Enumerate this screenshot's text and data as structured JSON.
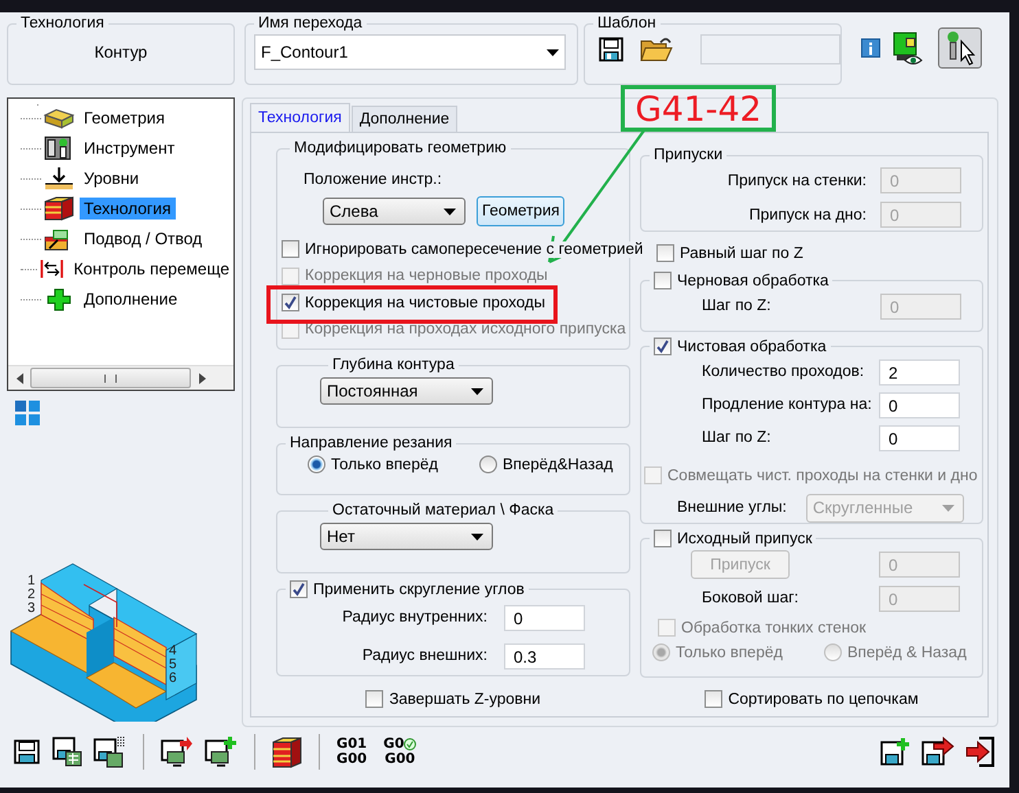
{
  "technology": {
    "label": "Технология",
    "value": "Контур"
  },
  "operation_name": {
    "label": "Имя перехода",
    "value": "F_Contour1"
  },
  "template": {
    "label": "Шаблон"
  },
  "tree": [
    {
      "label": "Геометрия",
      "kind": "geometry",
      "selected": false
    },
    {
      "label": "Инструмент",
      "kind": "tool",
      "selected": false
    },
    {
      "label": "Уровни",
      "kind": "levels",
      "selected": false
    },
    {
      "label": "Технология",
      "kind": "technology",
      "selected": true
    },
    {
      "label": "Подвод / Отвод",
      "kind": "approach",
      "selected": false
    },
    {
      "label": "Контроль перемеще",
      "kind": "motion",
      "selected": false
    },
    {
      "label": "Дополнение",
      "kind": "addition",
      "selected": false
    }
  ],
  "drawing_numbers": [
    "1",
    "2",
    "3",
    "4",
    "5",
    "6"
  ],
  "tabs": [
    {
      "label": "Технология",
      "selected": true
    },
    {
      "label": "Дополнение",
      "selected": false
    }
  ],
  "modify_geometry": {
    "title": "Модифицировать геометрию",
    "tool_position_label": "Положение инстр.:",
    "tool_position": "Слева",
    "geometry_button": "Геометрия",
    "options": [
      {
        "label": "Игнорировать самопересечение с геометрией",
        "checked": false,
        "disabled": false
      },
      {
        "label": "Коррекция на черновые проходы",
        "checked": false,
        "disabled": true
      },
      {
        "label": "Коррекция на чистовые проходы",
        "checked": true,
        "disabled": false
      },
      {
        "label": "Коррекция на проходах исходного припуска",
        "checked": false,
        "disabled": true
      }
    ]
  },
  "contour_depth": {
    "title": "Глубина контура",
    "value": "Постоянная"
  },
  "cut_direction": {
    "title": "Направление резания",
    "options": [
      {
        "label": "Только вперёд",
        "selected": true
      },
      {
        "label": "Вперёд&Назад",
        "selected": false
      }
    ]
  },
  "residual": {
    "title": "Остаточный материал \\ Фаска",
    "value": "Нет"
  },
  "corner_rounding": {
    "title": "Применить скругление углов",
    "checked": true,
    "fields": [
      {
        "label": "Радиус внутренних:",
        "value": "0"
      },
      {
        "label": "Радиус внешних:",
        "value": "0.3"
      }
    ]
  },
  "finish_z_levels": {
    "label": "Завершать Z-уровни",
    "checked": false
  },
  "allowances": {
    "title": "Припуски",
    "fields": [
      {
        "label": "Припуск на стенки:",
        "value": "0",
        "disabled": true
      },
      {
        "label": "Припуск на дно:",
        "value": "0",
        "disabled": true
      }
    ]
  },
  "equal_z_step": {
    "label": "Равный шаг по Z",
    "checked": false
  },
  "roughing": {
    "title": "Черновая обработка",
    "checked": false,
    "fields": [
      {
        "label": "Шаг по Z:",
        "value": "0",
        "disabled": true
      }
    ]
  },
  "finishing": {
    "title": "Чистовая обработка",
    "checked": true,
    "fields": [
      {
        "label": "Количество проходов:",
        "value": "2",
        "disabled": false
      },
      {
        "label": "Продление контура на:",
        "value": "0",
        "disabled": false
      },
      {
        "label": "Шаг по Z:",
        "value": "0",
        "disabled": false
      }
    ],
    "combine": {
      "label": "Совмещать чист. проходы на стенки и дно",
      "checked": false,
      "disabled": true
    },
    "outer_corners": {
      "label": "Внешние углы:",
      "value": "Скругленные",
      "disabled": true
    }
  },
  "initial_stock": {
    "title": "Исходный припуск",
    "checked": false,
    "button": "Припуск",
    "button_value": "0",
    "side_step_label": "Боковой шаг:",
    "side_step": "0",
    "thin_walls": {
      "label": "Обработка тонких стенок",
      "checked": false,
      "disabled": true
    },
    "directions": [
      {
        "label": "Только вперёд",
        "selected": true
      },
      {
        "label": "Вперёд & Назад",
        "selected": false
      }
    ]
  },
  "sort_chains": {
    "label": "Сортировать по цепочкам",
    "checked": false
  },
  "gcode_buttons": [
    {
      "top": "G01",
      "bottom": "G00",
      "kind": "plain"
    },
    {
      "top": "G0",
      "bottom": "G00",
      "kind": "status"
    }
  ],
  "annotation": {
    "label": "G41-42"
  }
}
